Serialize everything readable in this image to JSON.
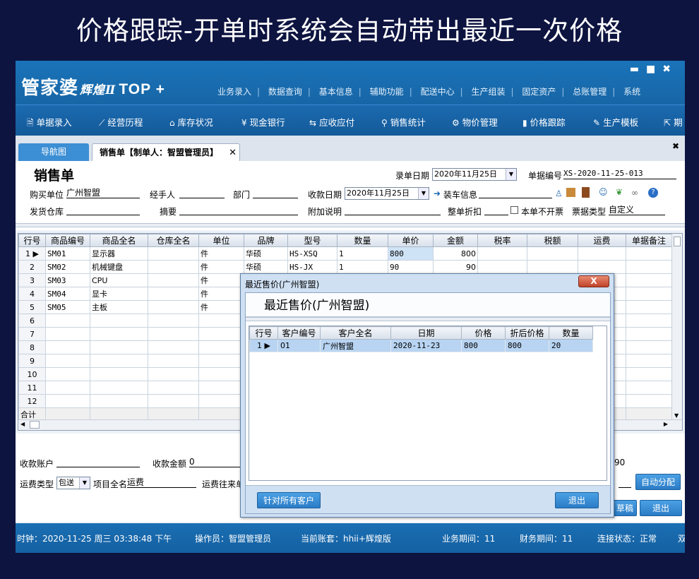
{
  "banner": {
    "title": "价格跟踪-开单时系统会自动带出最近一次价格"
  },
  "app": {
    "logo": {
      "main": "管家婆",
      "edition": "辉煌Ⅱ",
      "version": "TOP +"
    },
    "window_controls": {
      "minimize": "▬",
      "maximize": "■",
      "close": "✖"
    },
    "top_menu": [
      "业务录入",
      "数据查询",
      "基本信息",
      "辅助功能",
      "配送中心",
      "生产组装",
      "固定资产",
      "总账管理",
      "系统"
    ],
    "toolbar": [
      {
        "icon": "document-edit-icon",
        "glyph": "🗎",
        "label": "单据录入"
      },
      {
        "icon": "line-chart-icon",
        "glyph": "⟋",
        "label": "经营历程"
      },
      {
        "icon": "home-icon",
        "glyph": "⌂",
        "label": "库存状况"
      },
      {
        "icon": "yen-icon",
        "glyph": "¥",
        "label": "现金银行"
      },
      {
        "icon": "exchange-icon",
        "glyph": "⇆",
        "label": "应收应付"
      },
      {
        "icon": "search-icon",
        "glyph": "⚲",
        "label": "销售统计"
      },
      {
        "icon": "gear-icon",
        "glyph": "⚙",
        "label": "物价管理"
      },
      {
        "icon": "bar-chart-icon",
        "glyph": "▮",
        "label": "价格跟踪"
      },
      {
        "icon": "wrench-icon",
        "glyph": "✎",
        "label": "生产模板"
      },
      {
        "icon": "external-icon",
        "glyph": "⇱",
        "label": "期"
      }
    ],
    "tabs": {
      "nav": "导航图",
      "sale": "销售单【制单人：智盟管理员】",
      "sale_close": "✕",
      "close_all": "✖"
    },
    "form": {
      "title": "销售单",
      "entry_date_label": "录单日期",
      "entry_date": "2020年11月25日",
      "bill_no_label": "单据编号",
      "bill_no": "XS-2020-11-25-013",
      "buyer_label": "购买单位",
      "buyer": "广州智盟",
      "handler_label": "经手人",
      "handler": "",
      "dept_label": "部门",
      "dept": "",
      "receipt_date_label": "收款日期",
      "receipt_date": "2020年11月25日",
      "loading_label": "装车信息",
      "warehouse_label": "发货仓库",
      "warehouse": "",
      "summary_label": "摘要",
      "summary": "",
      "extra_label": "附加说明",
      "extra": "",
      "discount_label": "整单折扣",
      "discount": "",
      "no_invoice_label": "本单不开票",
      "bill_type_label": "票据类型",
      "bill_type": "自定义"
    },
    "grid": {
      "columns": [
        "行号",
        "商品编号",
        "商品全名",
        "仓库全名",
        "单位",
        "品牌",
        "型号",
        "数量",
        "单价",
        "金额",
        "税率",
        "税额",
        "运费",
        "单据备注"
      ],
      "rows": [
        [
          "1",
          "SM01",
          "显示器",
          "",
          "件",
          "华硕",
          "HS-XSQ",
          "1",
          "800",
          "800",
          "",
          "",
          "",
          ""
        ],
        [
          "2",
          "SM02",
          "机械键盘",
          "",
          "件",
          "华硕",
          "HS-JX",
          "1",
          "90",
          "90",
          "",
          "",
          "",
          ""
        ],
        [
          "3",
          "SM03",
          "CPU",
          "",
          "件",
          "",
          "",
          "",
          "",
          "",
          "",
          "",
          "",
          ""
        ],
        [
          "4",
          "SM04",
          "显卡",
          "",
          "件",
          "",
          "",
          "",
          "",
          "",
          "",
          "",
          "",
          ""
        ],
        [
          "5",
          "SM05",
          "主板",
          "",
          "件",
          "",
          "",
          "",
          "",
          "",
          "",
          "",
          "",
          ""
        ],
        [
          "6",
          "",
          "",
          "",
          "",
          "",
          "",
          "",
          "",
          "",
          "",
          "",
          "",
          ""
        ],
        [
          "7",
          "",
          "",
          "",
          "",
          "",
          "",
          "",
          "",
          "",
          "",
          "",
          "",
          ""
        ],
        [
          "8",
          "",
          "",
          "",
          "",
          "",
          "",
          "",
          "",
          "",
          "",
          "",
          "",
          ""
        ],
        [
          "9",
          "",
          "",
          "",
          "",
          "",
          "",
          "",
          "",
          "",
          "",
          "",
          "",
          ""
        ],
        [
          "10",
          "",
          "",
          "",
          "",
          "",
          "",
          "",
          "",
          "",
          "",
          "",
          "",
          ""
        ],
        [
          "11",
          "",
          "",
          "",
          "",
          "",
          "",
          "",
          "",
          "",
          "",
          "",
          "",
          ""
        ],
        [
          "12",
          "",
          "",
          "",
          "",
          "",
          "",
          "",
          "",
          "",
          "",
          "",
          "",
          ""
        ]
      ],
      "total_label": "合计"
    },
    "bottom": {
      "account_label": "收款账户",
      "account": "",
      "amount_label": "收款金额",
      "amount": "0",
      "right_value": "90",
      "freight_type_label": "运费类型",
      "freight_type": "包送",
      "item_name_label": "项目全名",
      "item_name": "运费",
      "freight_unit_label": "运费往来单",
      "auto_alloc": "自动分配",
      "draft": "草稿",
      "exit": "退出"
    },
    "status": {
      "clock": "时钟：2020-11-25 周三 03:38:48 下午",
      "operator": "操作员：智盟管理员",
      "account": "当前账套：hhii+辉煌版",
      "biz_period": "业务期间：11",
      "fin_period": "财务期间：11",
      "conn": "连接状态：正常",
      "extra": "双"
    },
    "dialog": {
      "title": "最近售价(广州智盟)",
      "close": "X",
      "heading": "最近售价(广州智盟)",
      "columns": [
        "行号",
        "客户编号",
        "客户全名",
        "日期",
        "价格",
        "折后价格",
        "数量"
      ],
      "rows": [
        [
          "1",
          "01",
          "广州智盟",
          "2020-11-23",
          "800",
          "800",
          "20"
        ]
      ],
      "btn_all": "针对所有客户",
      "btn_exit": "退出"
    }
  }
}
